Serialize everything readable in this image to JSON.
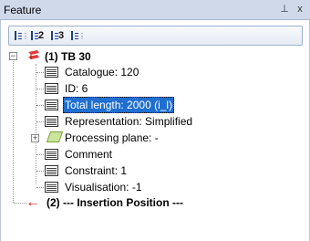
{
  "window": {
    "title": "Feature"
  },
  "titlebar_buttons": {
    "pin_glyph": "⊥",
    "close_glyph": "x"
  },
  "toolbar": {
    "tools": [
      {
        "icon": "expand-all-icon",
        "label": ""
      },
      {
        "icon": "level-2-icon",
        "label": "2"
      },
      {
        "icon": "level-3-icon",
        "label": "3"
      },
      {
        "icon": "collapse-all-icon",
        "label": ""
      }
    ]
  },
  "tree": {
    "root": {
      "label": "(1) TB 30",
      "expander": "−"
    },
    "items": [
      {
        "label": "Catalogue: 120"
      },
      {
        "label": "ID: 6"
      },
      {
        "label": "Total length: 2000 (i_l)",
        "selected": true
      },
      {
        "label": "Representation: Simplified"
      },
      {
        "label": "Processing plane: -",
        "expander": "+"
      },
      {
        "label": "Comment"
      },
      {
        "label": "Constraint: 1"
      },
      {
        "label": "Visualisation: -1"
      }
    ],
    "insertion": {
      "label": "(2) --- Insertion Position ---"
    }
  }
}
